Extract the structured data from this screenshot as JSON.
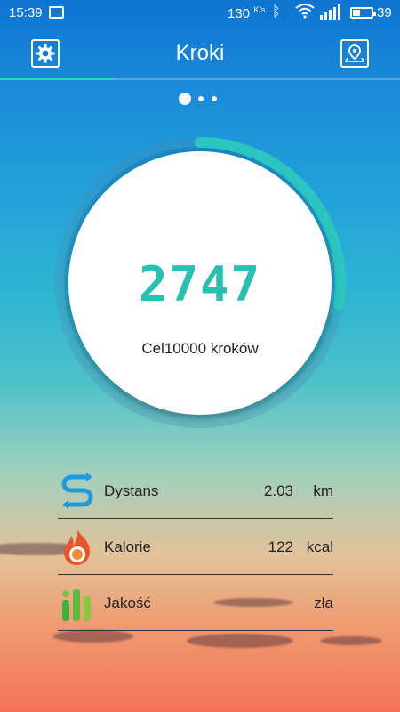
{
  "status_bar": {
    "time": "15:39",
    "network_speed": "130",
    "network_speed_unit": "K/s",
    "battery_level": "39",
    "icons": [
      "message-icon",
      "bluetooth-icon",
      "wifi-icon",
      "signal-icon",
      "battery-icon"
    ]
  },
  "header": {
    "title": "Kroki",
    "left_icon": "gear-icon",
    "right_icon": "location-pin-icon"
  },
  "pager": {
    "pages": 3,
    "active_index": 0
  },
  "progress": {
    "steps": "2747",
    "goal_text": "Cel10000 kroków",
    "goal_steps": 10000,
    "fraction": 0.2747,
    "color": "#2bbfb2"
  },
  "stats": [
    {
      "label": "Dystans",
      "value": "2.03",
      "unit": "km",
      "icon": "distance-icon",
      "color": "#1e9be0"
    },
    {
      "label": "Kalorie",
      "value": "122",
      "unit": "kcal",
      "icon": "flame-icon",
      "color": "#e8552a"
    },
    {
      "label": "Jakość",
      "value": "zła",
      "unit": "",
      "icon": "quality-bars-icon",
      "color": "#3cb33c"
    }
  ]
}
